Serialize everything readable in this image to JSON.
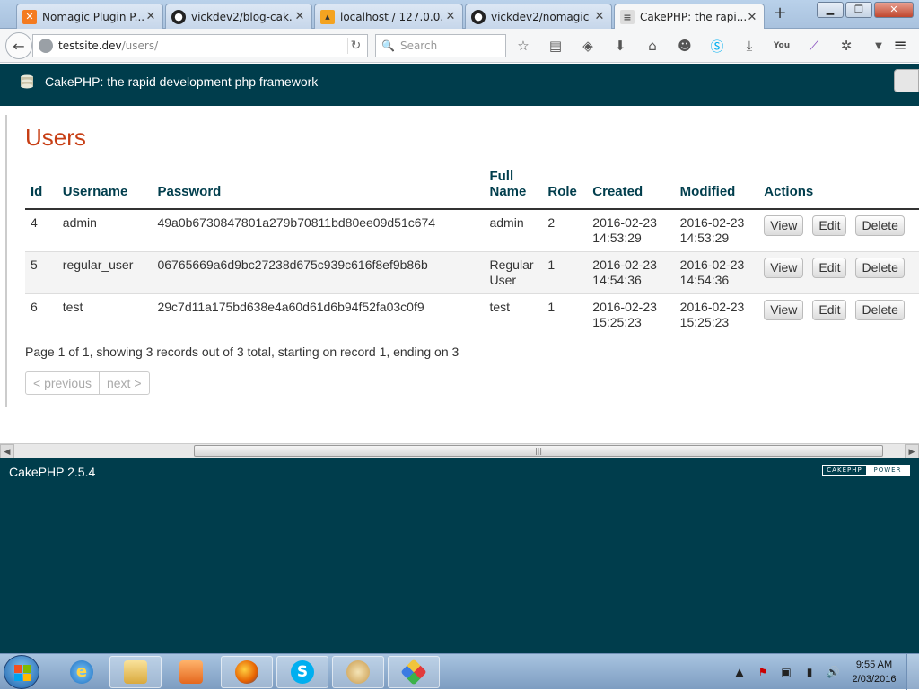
{
  "browser": {
    "tabs": [
      {
        "label": "Nomagic Plugin P...",
        "icon": "xampp-icon"
      },
      {
        "label": "vickdev2/blog-cak...",
        "icon": "github-icon"
      },
      {
        "label": "localhost / 127.0.0....",
        "icon": "phpmyadmin-icon"
      },
      {
        "label": "vickdev2/nomagic",
        "icon": "github-icon"
      },
      {
        "label": "CakePHP: the rapi...",
        "icon": "cakephp-icon"
      }
    ],
    "url_host": "testsite.dev",
    "url_path": "/users/",
    "search_placeholder": "Search"
  },
  "page": {
    "site_title": "CakePHP: the rapid development php framework",
    "heading": "Users",
    "table": {
      "headers": [
        "Id",
        "Username",
        "Password",
        "Full Name",
        "Role",
        "Created",
        "Modified",
        "Actions"
      ],
      "rows": [
        {
          "id": "4",
          "username": "admin",
          "password": "49a0b6730847801a279b70811bd80ee09d51c674",
          "full_name": "admin",
          "role": "2",
          "created": "2016-02-23 14:53:29",
          "modified": "2016-02-23 14:53:29"
        },
        {
          "id": "5",
          "username": "regular_user",
          "password": "06765669a6d9bc27238d675c939c616f8ef9b86b",
          "full_name": "Regular User",
          "role": "1",
          "created": "2016-02-23 14:54:36",
          "modified": "2016-02-23 14:54:36"
        },
        {
          "id": "6",
          "username": "test",
          "password": "29c7d11a175bd638e4a60d61d6b94f52fa03c0f9",
          "full_name": "test",
          "role": "1",
          "created": "2016-02-23 15:25:23",
          "modified": "2016-02-23 15:25:23"
        }
      ],
      "actions": {
        "view": "View",
        "edit": "Edit",
        "delete": "Delete"
      }
    },
    "paging_text": "Page 1 of 1, showing 3 records out of 3 total, starting on record 1, ending on 3",
    "prev_label": "< previous",
    "next_label": "next >",
    "footer_version": "CakePHP 2.5.4",
    "power_badge": [
      "CAKEPHP",
      "POWER"
    ]
  },
  "taskbar": {
    "clock_time": "9:55 AM",
    "clock_date": "2/03/2016"
  },
  "colors": {
    "header_bg": "#003d4c",
    "title_red": "#c73e14"
  }
}
